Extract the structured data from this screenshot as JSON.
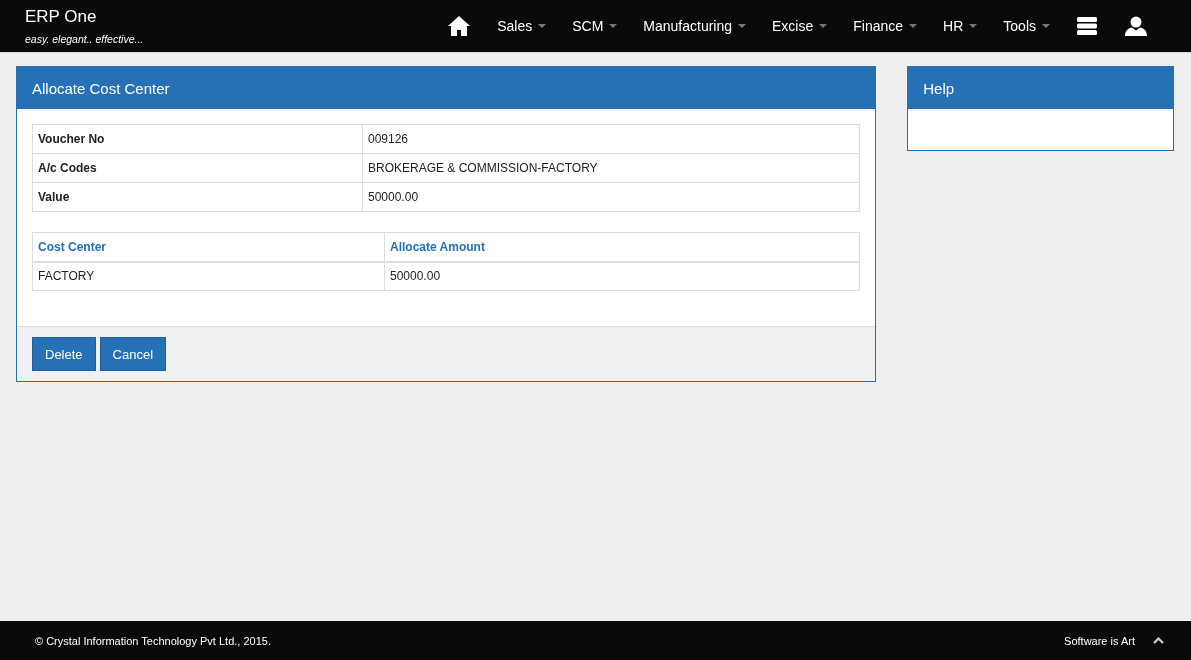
{
  "brand": {
    "title": "ERP One",
    "tagline": "easy. elegant.. effective..."
  },
  "nav": [
    {
      "label": "Sales"
    },
    {
      "label": "SCM"
    },
    {
      "label": "Manufacturing"
    },
    {
      "label": "Excise"
    },
    {
      "label": "Finance"
    },
    {
      "label": "HR"
    },
    {
      "label": "Tools"
    }
  ],
  "panel": {
    "title": "Allocate Cost Center",
    "details": [
      {
        "label": "Voucher No",
        "value": "009126"
      },
      {
        "label": "A/c Codes",
        "value": "BROKERAGE & COMMISSION-FACTORY"
      },
      {
        "label": "Value",
        "value": "50000.00"
      }
    ],
    "allocation": {
      "columns": [
        "Cost Center",
        "Allocate Amount"
      ],
      "rows": [
        [
          "FACTORY",
          "50000.00"
        ]
      ]
    },
    "buttons": [
      "Delete",
      "Cancel"
    ]
  },
  "help": {
    "title": "Help"
  },
  "footer": {
    "copyright": "© Crystal Information Technology Pvt Ltd., 2015.",
    "slogan": "Software is Art"
  }
}
